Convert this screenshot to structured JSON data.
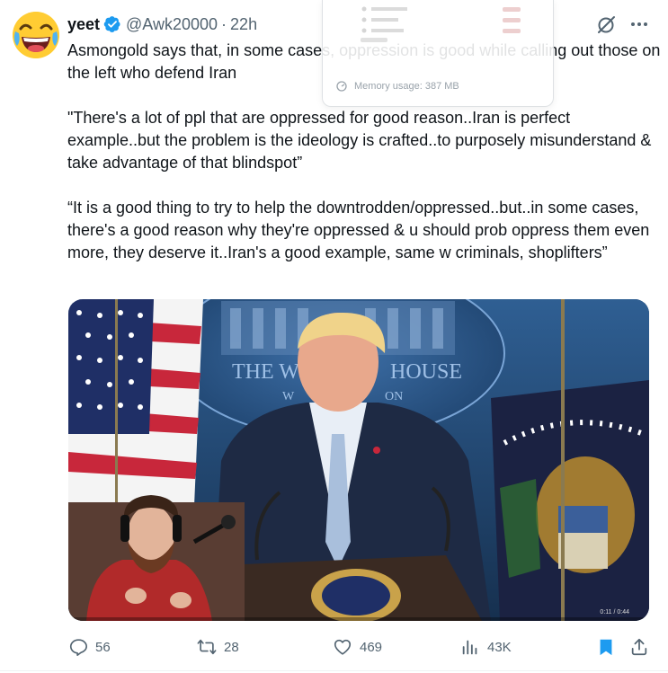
{
  "author": {
    "name": "yeet",
    "handle": "@Awk20000",
    "separator": "·",
    "time": "22h",
    "verified": true,
    "avatar_icon": "laughing-emoji-icon"
  },
  "tweet": {
    "paragraphs": [
      "Asmongold says that, in some cases, oppression is good while calling out those on the left who defend Iran",
      "\"There's a lot of ppl that are oppressed for good reason..Iran is perfect example..but the problem is the ideology is crafted..to purposely misunderstand & take advantage of that blindspot”",
      "“It is a good thing to try to help the downtrodden/oppressed..but..in some cases, there's a good reason why they're oppressed & u should prob oppress them even more, they deserve it..Iran's a good example, same w criminals, shoplifters”"
    ]
  },
  "overlay": {
    "memory_usage": "Memory usage: 387 MB"
  },
  "media": {
    "backdrop_text_1": "THE W",
    "backdrop_text_2": "HOUSE",
    "backdrop_text_3": "W",
    "backdrop_text_4": "ON",
    "video_timestamp": "0:11 / 0:44"
  },
  "actions": {
    "replies": "56",
    "reposts": "28",
    "likes": "469",
    "views": "43K"
  },
  "colors": {
    "accent": "#1d9bf0",
    "muted": "#536471",
    "text": "#0f1419"
  }
}
